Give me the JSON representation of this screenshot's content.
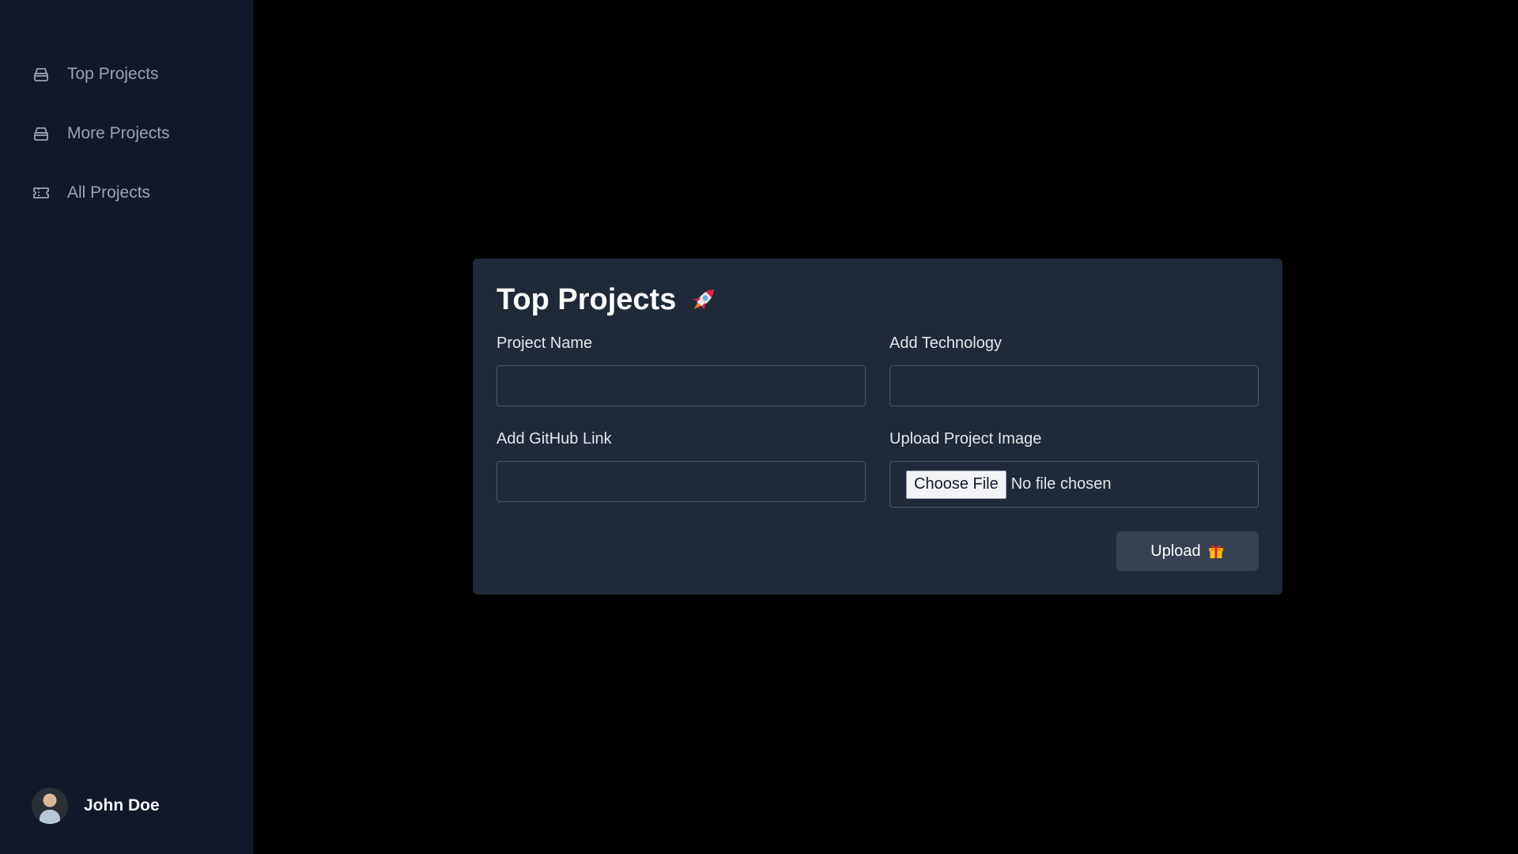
{
  "sidebar": {
    "items": [
      {
        "label": "Top Projects",
        "icon": "box-icon"
      },
      {
        "label": "More Projects",
        "icon": "box-icon"
      },
      {
        "label": "All Projects",
        "icon": "ticket-icon"
      }
    ],
    "user": {
      "name": "John Doe"
    }
  },
  "form": {
    "title": "Top Projects",
    "title_icon": "rocket-icon",
    "project_name_label": "Project Name",
    "project_name_value": "",
    "technology_label": "Add Technology",
    "technology_value": "",
    "github_label": "Add GitHub Link",
    "github_value": "",
    "image_label": "Upload Project Image",
    "choose_file_label": "Choose File",
    "file_status": "No file chosen",
    "upload_label": "Upload",
    "upload_icon": "gift-icon"
  },
  "colors": {
    "sidebar_bg": "#111827",
    "card_bg": "#1f2937",
    "button_bg": "#374151",
    "page_bg": "#000000"
  }
}
